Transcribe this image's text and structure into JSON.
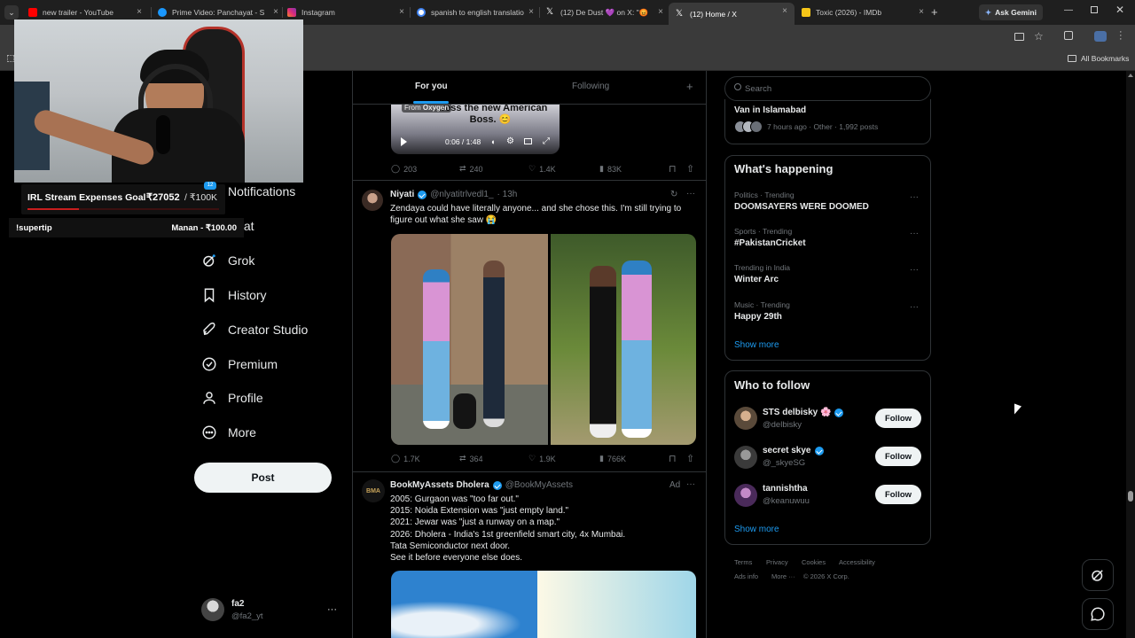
{
  "browser": {
    "tabs": [
      {
        "title": "new trailer - YouTube",
        "color": "#ff0000"
      },
      {
        "title": "Prime Video: Panchayat - S",
        "color": "#1a98ff"
      },
      {
        "title": "Instagram",
        "color": "#e1306c"
      },
      {
        "title": "spanish to english translatio",
        "color": "#4285f4"
      },
      {
        "title": "(12) De Dust 💜 on X: \"😡",
        "color": "#ffffff"
      },
      {
        "title": "(12) Home / X",
        "color": "#ffffff"
      },
      {
        "title": "Toxic (2026) - IMDb",
        "color": "#f5c518"
      }
    ],
    "new_tab": "+",
    "ask_gemini": "Ask Gemini",
    "bookmarks_label": "All Bookmarks"
  },
  "stream_overlay": {
    "goal_label": "IRL Stream Expenses Goal",
    "goal_current": "₹27052",
    "goal_target": "/ ₹100K",
    "tipper": "!supertip",
    "tip_text": "Manan - ₹100.00",
    "avatar_badge": "12"
  },
  "nav": {
    "items": [
      {
        "label": "Notifications",
        "icon": "bell-icon"
      },
      {
        "label": "Chat",
        "icon": "chat-icon"
      },
      {
        "label": "Grok",
        "icon": "grok-icon"
      },
      {
        "label": "History",
        "icon": "bookmark-icon"
      },
      {
        "label": "Creator Studio",
        "icon": "rocket-icon"
      },
      {
        "label": "Premium",
        "icon": "verified-icon"
      },
      {
        "label": "Profile",
        "icon": "person-icon"
      },
      {
        "label": "More",
        "icon": "more-circle-icon"
      }
    ],
    "post_label": "Post",
    "account": {
      "name": "fa2",
      "handle": "@fa2_yt",
      "more": "···"
    }
  },
  "feed": {
    "tabs": {
      "for_you": "For you",
      "following": "Following",
      "add": "+"
    },
    "video_post": {
      "from_label": "From",
      "from_source": "Oxygen",
      "video_caption": "...ress the new American Boss. 😊",
      "time": "0:06 / 1:48",
      "stats": {
        "replies": "203",
        "reposts": "240",
        "likes": "1.4K",
        "views": "83K"
      }
    },
    "post2": {
      "name": "Niyati",
      "handle": "@nlyatitrlvedl1_",
      "time": "· 13h",
      "text": "Zendaya could have literally anyone... and she chose this. I'm still trying to figure out what she saw 😭",
      "stats": {
        "replies": "1.7K",
        "reposts": "364",
        "likes": "1.9K",
        "views": "766K"
      }
    },
    "post3": {
      "name": "BookMyAssets Dholera",
      "handle": "@BookMyAssets",
      "ad_label": "Ad",
      "avatar_text": "BMA",
      "lines": [
        "2005: Gurgaon was \"too far out.\"",
        "2015: Noida Extension was \"just empty land.\"",
        "2021: Jewar was \"just a runway on a map.\"",
        "2026: Dholera - India's 1st greenfield smart city, 4x Mumbai.",
        "Tata Semiconductor next door.",
        "See it before everyone else does."
      ]
    }
  },
  "sidebar": {
    "search_placeholder": "Search",
    "top_card": {
      "title": "Van in Islamabad",
      "meta": "7 hours ago · Other · 1,992 posts"
    },
    "whats_happening": {
      "title": "What's happening",
      "trends": [
        {
          "category": "Politics · Trending",
          "name": "DOOMSAYERS WERE DOOMED"
        },
        {
          "category": "Sports · Trending",
          "name": "#PakistanCricket"
        },
        {
          "category": "Trending in India",
          "name": "Winter Arc"
        },
        {
          "category": "Music · Trending",
          "name": "Happy 29th"
        }
      ],
      "show_more": "Show more"
    },
    "who_to_follow": {
      "title": "Who to follow",
      "users": [
        {
          "name": "STS delbisky 🌸",
          "handle": "@delbisky",
          "verified": true
        },
        {
          "name": "secret skye",
          "handle": "@_skyeSG",
          "verified": true
        },
        {
          "name": "tannishtha",
          "handle": "@keanuwuu",
          "verified": false
        }
      ],
      "follow_label": "Follow",
      "show_more": "Show more"
    },
    "footer": {
      "line1": [
        "Terms",
        "Privacy",
        "Cookies",
        "Accessibility"
      ],
      "line2": [
        "Ads info",
        "More ···",
        "© 2026 X Corp."
      ]
    }
  }
}
